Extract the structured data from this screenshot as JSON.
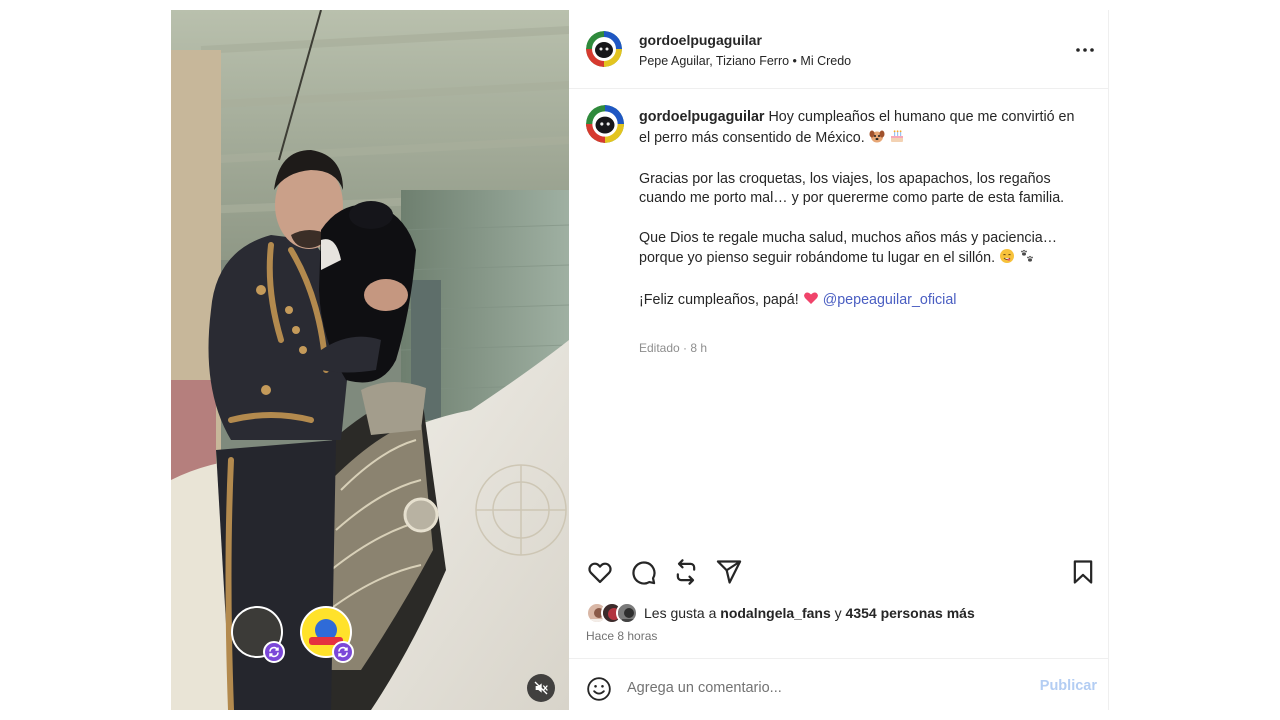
{
  "post": {
    "username": "gordoelpugaguilar",
    "audio": "Pepe Aguilar, Tiziano Ferro • Mi Credo",
    "caption": {
      "line1": "Hoy cumpleaños el humano que me convirtió en el perro más consentido de México.",
      "paragraph2": "Gracias por las croquetas, los viajes, los apapachos, los regaños cuando me porto mal… y por quererme como parte de esta familia.",
      "paragraph3": "Que Dios te regale mucha salud, muchos años más y paciencia… porque yo pienso seguir robándome tu lugar en el sillón.",
      "closing": "¡Feliz cumpleaños, papá!",
      "mention": "@pepeaguilar_oficial"
    },
    "edited_label": "Editado · 8 h",
    "likes_prefix": "Les gusta a",
    "likes_user": "nodalngela_fans",
    "likes_and": "y",
    "likes_count_text": "4354 personas más",
    "time_ago": "Hace 8 horas",
    "comment_placeholder": "Agrega un comentario...",
    "publish_label": "Publicar"
  },
  "icons": {
    "more": "more-horizontal-icon",
    "like": "heart-icon",
    "comment": "comment-bubble-icon",
    "repost": "repost-icon",
    "share": "send-icon",
    "save": "bookmark-icon",
    "emoji": "emoji-smile-icon",
    "mute": "speaker-muted-icon"
  },
  "colors": {
    "text": "#262626",
    "muted": "#8e8e8e",
    "mention": "#4a5ec2",
    "publish_disabled": "#b3cdf3",
    "border": "#efefef"
  }
}
